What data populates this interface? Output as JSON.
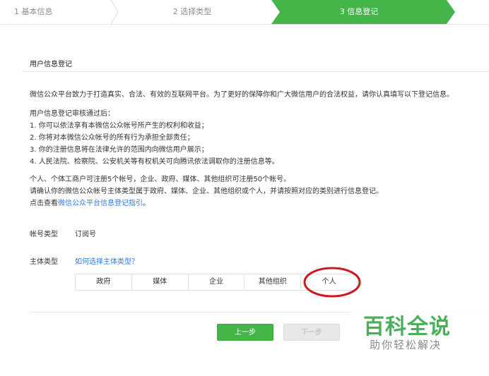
{
  "steps": {
    "step1": "1 基本信息",
    "step2": "2 选择类型",
    "step3": "3 信息登记"
  },
  "colors": {
    "accent_green": "#44b549",
    "link_blue": "#2f7ad8",
    "highlight_red": "#d0181b"
  },
  "section": {
    "title": "用户信息登记"
  },
  "intro": "微信公众平台致力于打造真实、合法、有效的互联网平台。为了更好的保障你和广大微信用户的合法权益，请你认真填写以下登记信息。",
  "review": {
    "heading": "用户信息登记审核通过后：",
    "items": [
      "1. 你可以依法享有本微信公众帐号所产生的权利和收益；",
      "2. 你将对本微信公众帐号的所有行为承担全部责任；",
      "3. 你的注册信息将在法律允许的范围内向微信用户展示；",
      "4. 人民法院、检察院、公安机关等有权机关可向腾讯依法调取你的注册信息等。"
    ]
  },
  "limits": {
    "line1": "个人、个体工商户可注册5个帐号，企业、政府、媒体、其他组织可注册50个帐号。",
    "line2": "请确认你的微信公众帐号主体类型属于政府、媒体、企业、其他组织或个人，并请按照对应的类别进行信息登记。",
    "line3_prefix": "点击查看",
    "line3_link": "微信公众平台信息登记指引",
    "line3_suffix": "。"
  },
  "form": {
    "account_type_label": "帐号类型",
    "account_type_value": "订阅号",
    "subject_type_label": "主体类型",
    "subject_help_link": "如何选择主体类型？",
    "subject_options": [
      "政府",
      "媒体",
      "企业",
      "其他组织",
      "个人"
    ]
  },
  "buttons": {
    "prev": "上一步",
    "next": "下一步"
  },
  "watermark": {
    "main": "百科全说",
    "sub": "助你轻松解决"
  }
}
